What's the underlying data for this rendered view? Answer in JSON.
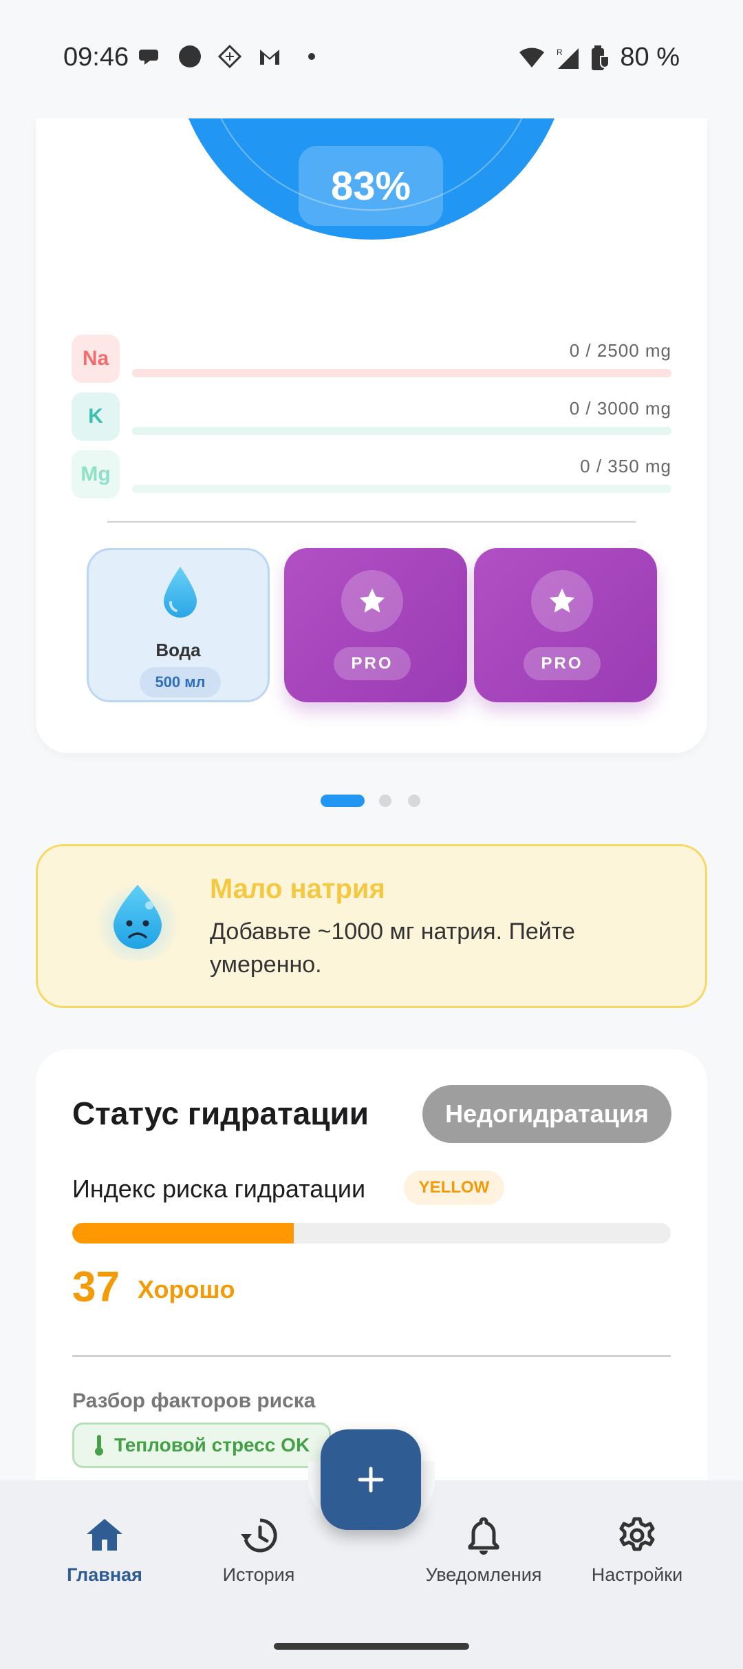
{
  "status_bar": {
    "time": "09:46",
    "battery": "80 %",
    "icons": [
      "chat-icon",
      "circle-icon",
      "diamond-grid-icon",
      "gmail-icon",
      "wifi-icon",
      "signal-roaming-icon",
      "battery-saver-icon"
    ]
  },
  "hydration_gauge": {
    "percent_label": "83%",
    "percent": 83,
    "color": "#2196f3"
  },
  "minerals": [
    {
      "symbol": "Na",
      "value": "0 / 2500 mg",
      "progress": 0,
      "color": "#f26d6d"
    },
    {
      "symbol": "K",
      "value": "0 / 3000 mg",
      "progress": 0,
      "color": "#3cbfae"
    },
    {
      "symbol": "Mg",
      "value": "0 / 350 mg",
      "progress": 0,
      "color": "#8ee0c6"
    }
  ],
  "drinks": {
    "water": {
      "label": "Вода",
      "amount": "500 мл"
    },
    "pro": [
      {
        "label": "PRO",
        "icon": "star-icon"
      },
      {
        "label": "PRO",
        "icon": "star-icon"
      }
    ]
  },
  "pager": {
    "pages": 3,
    "active": 0
  },
  "alert": {
    "title": "Мало натрия",
    "text": "Добавьте ~1000 мг натрия. Пейте умеренно.",
    "icon": "sad-drop-icon"
  },
  "status_card": {
    "title": "Статус гидратации",
    "badge": "Недогидратация",
    "risk_label": "Индекс риска гидратации",
    "risk_tag": "YELLOW",
    "risk_score": "37",
    "risk_progress": 0.37,
    "risk_word": "Хорошо",
    "factors_title": "Разбор факторов риска",
    "factor_chip": "Тепловой стресс OK",
    "accent": "#ff9800"
  },
  "nav": {
    "items": [
      {
        "label": "Главная",
        "icon": "home-icon",
        "active": true
      },
      {
        "label": "История",
        "icon": "history-icon",
        "active": false
      },
      {
        "label": "Уведомления",
        "icon": "bell-icon",
        "active": false
      },
      {
        "label": "Настройки",
        "icon": "gear-icon",
        "active": false
      }
    ],
    "fab_icon": "plus-icon"
  }
}
